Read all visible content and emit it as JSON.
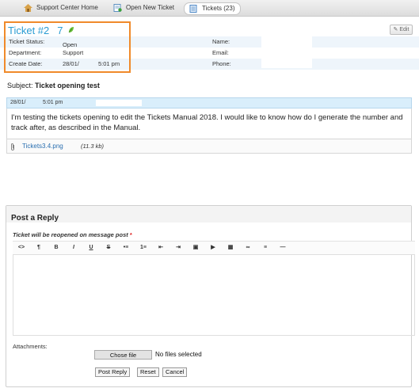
{
  "nav": {
    "items": [
      {
        "label": "Support Center Home",
        "icon": "home-icon",
        "active": false
      },
      {
        "label": "Open New Ticket",
        "icon": "new-ticket-icon",
        "active": false
      },
      {
        "label": "Tickets (23)",
        "icon": "tickets-icon",
        "active": true
      }
    ]
  },
  "ticket": {
    "title": "Ticket #2",
    "number_fragment": "7",
    "edit_label": "Edit",
    "status_label": "Ticket Status:",
    "status_value": "Open",
    "department_label": "Department:",
    "department_value": "Support",
    "created_label": "Create Date:",
    "created_date": "28/01/",
    "created_time": "5:01 pm",
    "name_label": "Name:",
    "email_label": "Email:",
    "phone_label": "Phone:"
  },
  "subject": {
    "label": "Subject:",
    "value": "Ticket opening test"
  },
  "message": {
    "date": "28/01/",
    "time": "5:01 pm",
    "body": "I'm testing the tickets opening to edit the Tickets Manual 2018. I would like to know how do I generate the number and track after, as described in the Manual.",
    "attachment_name": "Tickets3.4.png",
    "attachment_size": "(11.3 kb)"
  },
  "reply": {
    "title": "Post a Reply",
    "reopen_note": "Ticket will be reopened on message post",
    "required_mark": "*",
    "toolbar": [
      "<>",
      "¶",
      "B",
      "I",
      "U",
      "S",
      "•≡",
      "1≡",
      "⇤",
      "⇥",
      "▣",
      "▶",
      "▦",
      "∞",
      "≡",
      "—"
    ],
    "attachments_label": "Attachments:",
    "choose_file": "Chose file",
    "no_file": "No files selected",
    "post_button": "Post Reply",
    "reset_button": "Reset",
    "cancel_button": "Cancel"
  },
  "colors": {
    "accent": "#2a9cd3",
    "highlight": "#f08a2a",
    "row_alt": "#eef5fb",
    "message_header": "#d9eefb"
  }
}
